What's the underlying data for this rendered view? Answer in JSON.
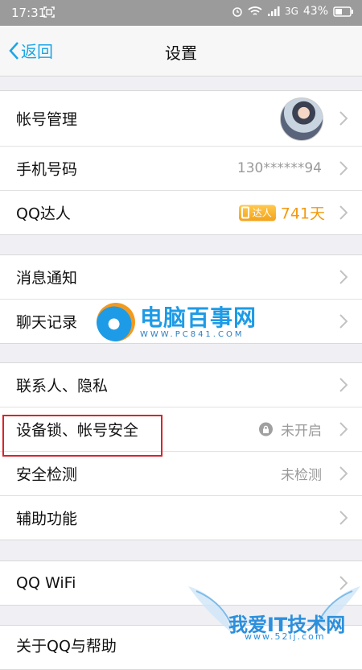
{
  "status_bar": {
    "time": "17:31",
    "network": "3G",
    "battery": "43%"
  },
  "navbar": {
    "back_label": "返回",
    "title": "设置"
  },
  "groups": [
    {
      "rows": [
        {
          "label": "帐号管理",
          "value": ""
        },
        {
          "label": "手机号码",
          "value": "130******94"
        },
        {
          "label": "QQ达人",
          "badge": "达人",
          "value": "741天"
        }
      ]
    },
    {
      "rows": [
        {
          "label": "消息通知",
          "value": ""
        },
        {
          "label": "聊天记录",
          "value": ""
        }
      ]
    },
    {
      "rows": [
        {
          "label": "联系人、隐私",
          "value": ""
        },
        {
          "label": "设备锁、帐号安全",
          "value": "未开启"
        },
        {
          "label": "安全检测",
          "value": "未检测"
        },
        {
          "label": "辅助功能",
          "value": ""
        }
      ]
    },
    {
      "rows": [
        {
          "label": "QQ WiFi",
          "value": ""
        }
      ]
    },
    {
      "rows": [
        {
          "label": "关于QQ与帮助",
          "value": ""
        }
      ]
    }
  ],
  "watermarks": {
    "pc841_title": "电脑百事网",
    "pc841_url": "WWW.PC841.COM",
    "it_title": "我爱IT技术网",
    "it_url": "www.52ij.com"
  },
  "colors": {
    "accent": "#1aa6e6",
    "highlight_border": "#d9232b",
    "days_orange": "#f29a0e"
  }
}
